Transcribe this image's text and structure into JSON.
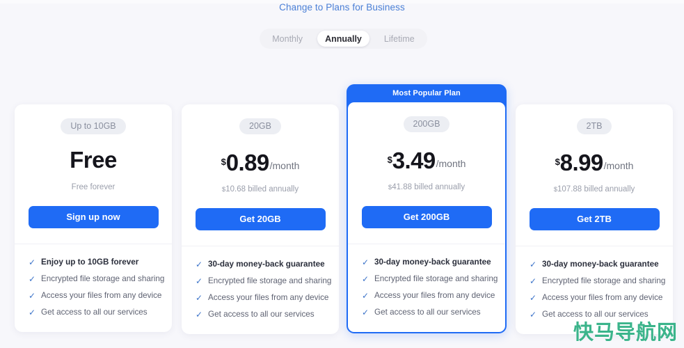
{
  "header": {
    "business_link": "Change to Plans for Business"
  },
  "billing_toggle": {
    "options": [
      {
        "label": "Monthly",
        "active": false
      },
      {
        "label": "Annually",
        "active": true
      },
      {
        "label": "Lifetime",
        "active": false
      }
    ]
  },
  "colors": {
    "accent": "#1f6bf5",
    "page_bg": "#f7f7fb",
    "link": "#4a7fd6",
    "badge_bg": "#eceef3",
    "check": "#3d74c9",
    "watermark": "#3bb48b"
  },
  "plans": [
    {
      "storage": "Up to 10GB",
      "price_is_free": true,
      "free_label": "Free",
      "currency": "",
      "amount": "",
      "period": "",
      "billed": "Free forever",
      "billed_currency": "",
      "cta": "Sign up now",
      "popular": false,
      "banner": "",
      "features": [
        {
          "text": "Enjoy up to 10GB forever",
          "bold": true
        },
        {
          "text": "Encrypted file storage and sharing",
          "bold": false
        },
        {
          "text": "Access your files from any device",
          "bold": false
        },
        {
          "text": "Get access to all our services",
          "bold": false
        }
      ]
    },
    {
      "storage": "20GB",
      "price_is_free": false,
      "free_label": "",
      "currency": "$",
      "amount": "0.89",
      "period": "/month",
      "billed": "10.68 billed annually",
      "billed_currency": "$",
      "cta": "Get 20GB",
      "popular": false,
      "banner": "",
      "features": [
        {
          "text": "30-day money-back guarantee",
          "bold": true
        },
        {
          "text": "Encrypted file storage and sharing",
          "bold": false
        },
        {
          "text": "Access your files from any device",
          "bold": false
        },
        {
          "text": "Get access to all our services",
          "bold": false
        }
      ]
    },
    {
      "storage": "200GB",
      "price_is_free": false,
      "free_label": "",
      "currency": "$",
      "amount": "3.49",
      "period": "/month",
      "billed": "41.88 billed annually",
      "billed_currency": "$",
      "cta": "Get 200GB",
      "popular": true,
      "banner": "Most Popular Plan",
      "features": [
        {
          "text": "30-day money-back guarantee",
          "bold": true
        },
        {
          "text": "Encrypted file storage and sharing",
          "bold": false
        },
        {
          "text": "Access your files from any device",
          "bold": false
        },
        {
          "text": "Get access to all our services",
          "bold": false
        }
      ]
    },
    {
      "storage": "2TB",
      "price_is_free": false,
      "free_label": "",
      "currency": "$",
      "amount": "8.99",
      "period": "/month",
      "billed": "107.88 billed annually",
      "billed_currency": "$",
      "cta": "Get 2TB",
      "popular": false,
      "banner": "",
      "features": [
        {
          "text": "30-day money-back guarantee",
          "bold": true
        },
        {
          "text": "Encrypted file storage and sharing",
          "bold": false
        },
        {
          "text": "Access your files from any device",
          "bold": false
        },
        {
          "text": "Get access to all our services",
          "bold": false
        }
      ]
    }
  ],
  "watermark": {
    "text": "快马导航网"
  },
  "icons": {
    "check": "✓"
  }
}
